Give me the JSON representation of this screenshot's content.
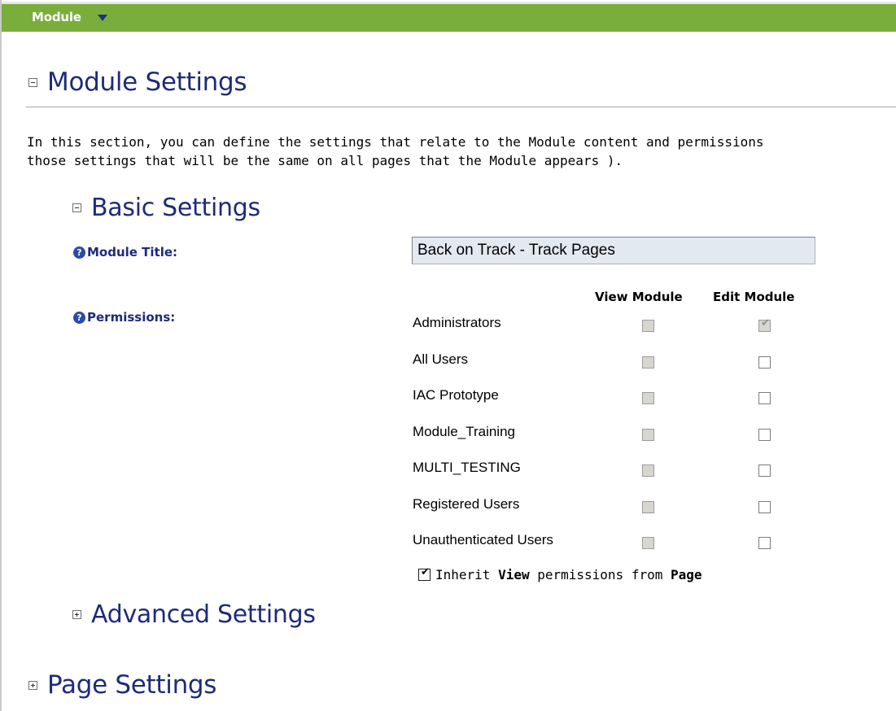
{
  "topbar": {
    "label": "Module"
  },
  "module_settings": {
    "title": "Module Settings",
    "intro_line1": "In this section, you can define the settings that relate to the Module content and permissions",
    "intro_line2": "those settings that will be the same on all pages that the Module appears )."
  },
  "basic_settings": {
    "title": "Basic Settings",
    "module_title_label": "Module Title:",
    "module_title_value": "Back on Track - Track Pages",
    "permissions_label": "Permissions:",
    "columns": [
      "View Module",
      "Edit Module"
    ],
    "roles": [
      {
        "name": "Administrators",
        "view": false,
        "edit": true
      },
      {
        "name": "All Users",
        "view": false,
        "edit": false
      },
      {
        "name": "IAC Prototype",
        "view": false,
        "edit": false
      },
      {
        "name": "Module_Training",
        "view": false,
        "edit": false
      },
      {
        "name": "MULTI_TESTING",
        "view": false,
        "edit": false
      },
      {
        "name": "Registered Users",
        "view": false,
        "edit": false
      },
      {
        "name": "Unauthenticated Users",
        "view": false,
        "edit": false
      }
    ],
    "inherit": {
      "checked": true,
      "part1": "Inherit ",
      "bold1": "View",
      "part2": " permissions from ",
      "bold2": "Page"
    }
  },
  "advanced_settings": {
    "title": "Advanced Settings"
  },
  "page_settings": {
    "title": "Page Settings"
  },
  "colors": {
    "topbar": "#7aae3c",
    "heading": "#1e2b78"
  }
}
